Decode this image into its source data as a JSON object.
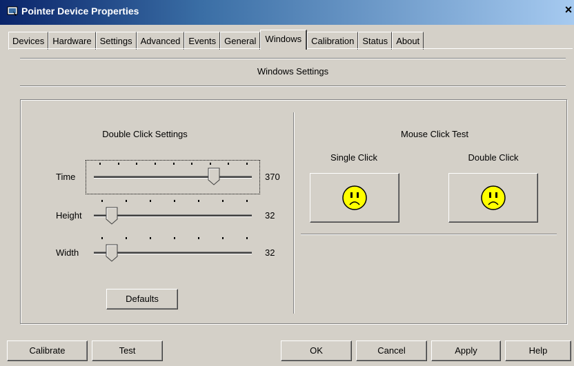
{
  "window": {
    "title": "Pointer Device Properties",
    "close_glyph": "×"
  },
  "tabs": [
    {
      "label": "Devices",
      "u": "D"
    },
    {
      "label": "Hardware",
      "u": "H"
    },
    {
      "label": "Settings",
      "u": "S"
    },
    {
      "label": "Advanced",
      "u": "v"
    },
    {
      "label": "Events",
      "u": "E"
    },
    {
      "label": "General",
      "u": "G"
    },
    {
      "label": "Windows",
      "u": "W",
      "active": true
    },
    {
      "label": "Calibration",
      "u": "n"
    },
    {
      "label": "Status",
      "u": "t"
    },
    {
      "label": "About",
      "u": ""
    }
  ],
  "panel": {
    "heading": "Windows Settings",
    "double_click": {
      "title": "Double Click Settings",
      "time": {
        "label": "Time",
        "value": "370",
        "level": 0.78
      },
      "height": {
        "label": "Height",
        "value": "32",
        "level": 0.08
      },
      "width": {
        "label": "Width",
        "value": "32",
        "level": 0.08
      },
      "defaults_label": "Defaults"
    },
    "mouse_test": {
      "title": "Mouse Click Test",
      "single_label": "Single Click",
      "double_label": "Double Click",
      "face_icon": "sad-face-icon",
      "face_color": "#ffff00"
    }
  },
  "buttons": {
    "calibrate": "Calibrate",
    "test": "Test",
    "ok": "OK",
    "cancel": "Cancel",
    "apply": "Apply",
    "help": "Help"
  }
}
